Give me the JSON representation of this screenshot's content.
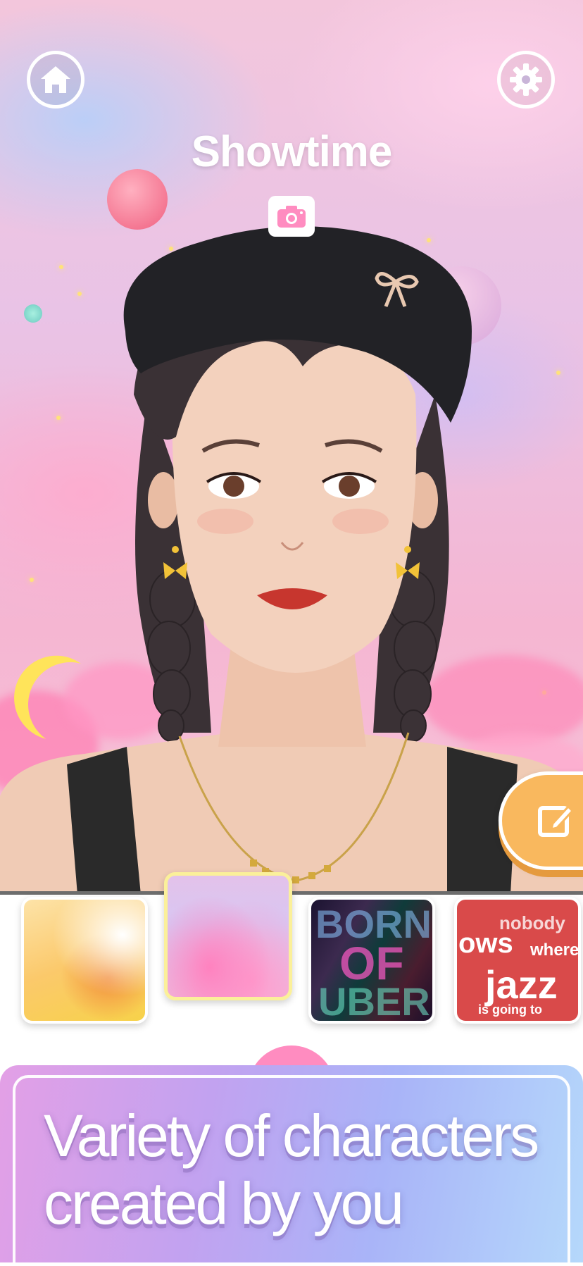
{
  "header": {
    "home_icon": "home-icon",
    "settings_icon": "gear-icon",
    "title": "Showtime",
    "camera_icon": "camera-icon"
  },
  "edit_button": {
    "icon": "edit-icon"
  },
  "backgrounds": {
    "selected_index": 1,
    "items": [
      {
        "name": "orange-watercolor"
      },
      {
        "name": "pink-clouds"
      },
      {
        "name": "neon-letters"
      },
      {
        "name": "red-typography"
      }
    ],
    "thumb4_words": [
      "nobody",
      "ows",
      "where",
      "jazz",
      "is going to"
    ]
  },
  "banner": {
    "line1": "Variety of characters",
    "line2": "created by you"
  },
  "colors": {
    "accent_orange": "#f9b85e",
    "selected_border": "#fbf09a",
    "camera_pink": "#ff8cc0"
  }
}
